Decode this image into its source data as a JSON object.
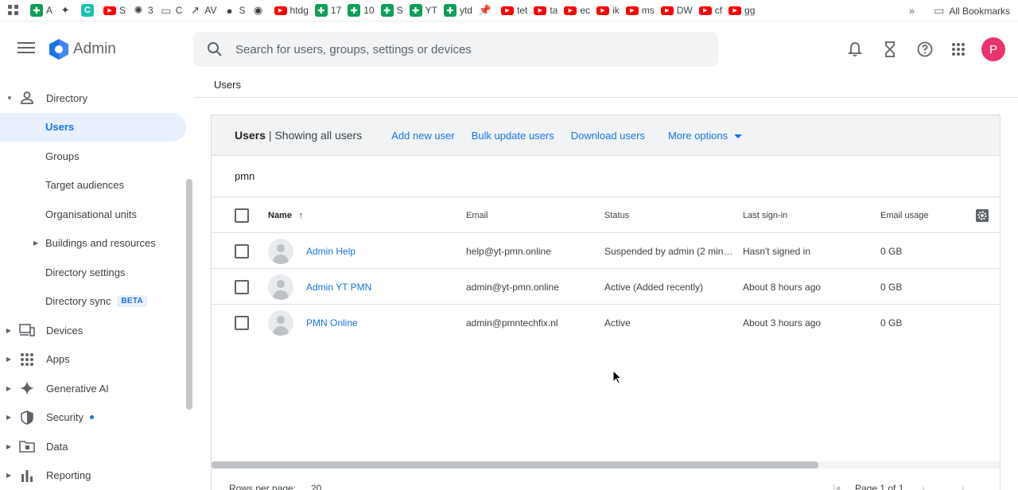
{
  "bookmarks": {
    "items": [
      {
        "icon": "sheet-icon",
        "label": "A"
      },
      {
        "icon": "puzzle-icon",
        "label": ""
      },
      {
        "icon": "teal-app-icon",
        "label": ""
      },
      {
        "icon": "youtube-icon",
        "label": "S"
      },
      {
        "icon": "openai-icon",
        "label": "3"
      },
      {
        "icon": "folder-icon",
        "label": "C"
      },
      {
        "icon": "trend-icon",
        "label": "AV"
      },
      {
        "icon": "globe-icon",
        "label": "S"
      },
      {
        "icon": "github-icon",
        "label": ""
      },
      {
        "icon": "youtube-icon",
        "label": "htdg"
      },
      {
        "icon": "sheet-icon",
        "label": "17"
      },
      {
        "icon": "sheet-icon",
        "label": "10"
      },
      {
        "icon": "sheet-icon",
        "label": "S"
      },
      {
        "icon": "sheet-icon",
        "label": "YT"
      },
      {
        "icon": "sheet-icon",
        "label": "ytd"
      },
      {
        "icon": "pin-icon",
        "label": ""
      },
      {
        "icon": "youtube-icon",
        "label": "tet"
      },
      {
        "icon": "youtube-icon",
        "label": "ta"
      },
      {
        "icon": "youtube-icon",
        "label": "ec"
      },
      {
        "icon": "youtube-icon",
        "label": "ik"
      },
      {
        "icon": "youtube-icon",
        "label": "ms"
      },
      {
        "icon": "youtube-icon",
        "label": "DW"
      },
      {
        "icon": "youtube-icon",
        "label": "cf"
      },
      {
        "icon": "youtube-icon",
        "label": "gg"
      }
    ],
    "overflow": "»",
    "all_bookmarks": "All Bookmarks"
  },
  "header": {
    "app_name": "Admin",
    "search_placeholder": "Search for users, groups, settings or devices",
    "avatar_letter": "P"
  },
  "sidebar": {
    "directory": "Directory",
    "users": "Users",
    "groups": "Groups",
    "target_audiences": "Target audiences",
    "org_units": "Organisational units",
    "buildings": "Buildings and resources",
    "dir_settings": "Directory settings",
    "dir_sync": "Directory sync",
    "beta": "BETA",
    "devices": "Devices",
    "apps": "Apps",
    "gen_ai": "Generative AI",
    "security": "Security",
    "data": "Data",
    "reporting": "Reporting"
  },
  "breadcrumb": "Users",
  "card": {
    "title": "Users",
    "subtitle": "| Showing all users",
    "actions": {
      "add": "Add new user",
      "bulk": "Bulk update users",
      "download": "Download users",
      "more": "More options"
    },
    "filter": "pmn"
  },
  "table": {
    "columns": {
      "name": "Name",
      "email": "Email",
      "status": "Status",
      "last_signin": "Last sign-in",
      "email_usage": "Email usage"
    },
    "rows": [
      {
        "name": "Admin Help",
        "email": "help@yt-pmn.online",
        "status": "Suspended by admin (2 min…",
        "last_signin": "Hasn't signed in",
        "usage": "0 GB"
      },
      {
        "name": "Admin YT PMN",
        "email": "admin@yt-pmn.online",
        "status": "Active (Added recently)",
        "last_signin": "About 8 hours ago",
        "usage": "0 GB"
      },
      {
        "name": "PMN Online",
        "email": "admin@pmntechfix.nl",
        "status": "Active",
        "last_signin": "About 3 hours ago",
        "usage": "0 GB"
      }
    ]
  },
  "footer": {
    "rows_per_page_label": "Rows per page:",
    "rows_per_page_value": "20",
    "page_label": "Page 1 of 1"
  },
  "colors": {
    "accent": "#1a73e8",
    "avatar": "#e8336d",
    "selected_bg": "#e8f0fe"
  }
}
